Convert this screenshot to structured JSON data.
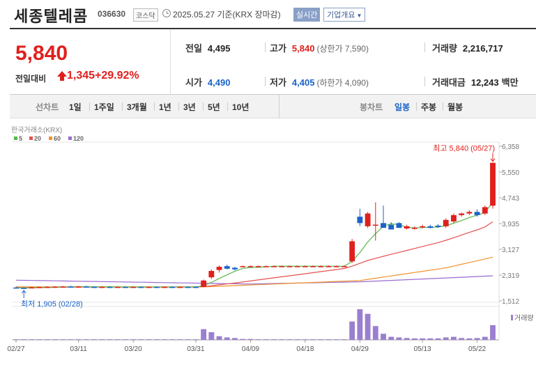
{
  "header": {
    "name": "세종텔레콤",
    "code": "036630",
    "market": "코스닥",
    "date_text": "2025.05.27 기준(KRX 장마감)",
    "realtime_label": "실시간",
    "overview_label": "기업개요",
    "overview_caret": "▼"
  },
  "summary": {
    "price": "5,840",
    "change_label": "전일대비",
    "change_value": "1,345",
    "change_pct": "+29.92%",
    "prev_close": {
      "label": "전일",
      "value": "4,495"
    },
    "high": {
      "label": "고가",
      "value": "5,840",
      "sub": "(상한가 7,590)"
    },
    "volume": {
      "label": "거래량",
      "value": "2,216,717"
    },
    "open": {
      "label": "시가",
      "value": "4,490"
    },
    "low": {
      "label": "저가",
      "value": "4,405",
      "sub": "(하한가 4,090)"
    },
    "amount": {
      "label": "거래대금",
      "value": "12,243",
      "unit": "백만"
    }
  },
  "periods": {
    "left": [
      "선차트",
      "1일",
      "1주일",
      "3개월",
      "1년",
      "3년",
      "5년",
      "10년"
    ],
    "right": [
      "봉차트",
      "일봉",
      "주봉",
      "월봉"
    ],
    "active": "일봉"
  },
  "colors": {
    "up": "#e0201d",
    "down": "#1a63c9",
    "ma5": "#55b84a",
    "ma20": "#e65050",
    "ma60": "#f0922b",
    "ma120": "#9a6bd0",
    "volume": "#9b7fcf"
  },
  "chart_data": {
    "type": "candlestick",
    "source_label": "한국거래소(KRX)",
    "legend": [
      {
        "name": "5",
        "color": "#55b84a"
      },
      {
        "name": "20",
        "color": "#e65050"
      },
      {
        "name": "60",
        "color": "#f0922b"
      },
      {
        "name": "120",
        "color": "#9a6bd0"
      }
    ],
    "y_ticks": [
      "6,358",
      "5,550",
      "4,743",
      "3,935",
      "3,127",
      "2,319",
      "1,512"
    ],
    "ylim": [
      1512,
      6358
    ],
    "x_ticks": [
      "02/27",
      "03/11",
      "03/20",
      "03/31",
      "04/09",
      "04/18",
      "04/29",
      "05/13",
      "05/22"
    ],
    "x_tick_index": [
      0,
      8,
      15,
      23,
      30,
      37,
      44,
      52,
      59
    ],
    "n_days": 62,
    "high_annotation": "최고 5,840 (05/27)",
    "low_annotation": "최저 1,905 (02/28)",
    "volume_label": "거래량",
    "candles": [
      [
        1930,
        1960,
        1900,
        1920
      ],
      [
        1920,
        1940,
        1905,
        1915
      ],
      [
        1915,
        1950,
        1905,
        1935
      ],
      [
        1935,
        1960,
        1920,
        1945
      ],
      [
        1945,
        1970,
        1930,
        1950
      ],
      [
        1950,
        1975,
        1935,
        1955
      ],
      [
        1955,
        1980,
        1940,
        1960
      ],
      [
        1960,
        1985,
        1945,
        1955
      ],
      [
        1955,
        1980,
        1940,
        1960
      ],
      [
        1960,
        1985,
        1945,
        1950
      ],
      [
        1950,
        1975,
        1935,
        1945
      ],
      [
        1945,
        1970,
        1930,
        1950
      ],
      [
        1950,
        1975,
        1935,
        1945
      ],
      [
        1945,
        1970,
        1930,
        1950
      ],
      [
        1950,
        1975,
        1935,
        1945
      ],
      [
        1945,
        1965,
        1930,
        1950
      ],
      [
        1950,
        1970,
        1935,
        1945
      ],
      [
        1945,
        1965,
        1930,
        1950
      ],
      [
        1950,
        1970,
        1935,
        1945
      ],
      [
        1945,
        1965,
        1930,
        1950
      ],
      [
        1950,
        1970,
        1935,
        1945
      ],
      [
        1945,
        1965,
        1930,
        1950
      ],
      [
        1950,
        1970,
        1935,
        1945
      ],
      [
        1950,
        1970,
        1935,
        1945
      ],
      [
        1950,
        2180,
        1940,
        2150
      ],
      [
        2250,
        2500,
        2200,
        2450
      ],
      [
        2480,
        2620,
        2400,
        2580
      ],
      [
        2600,
        2650,
        2500,
        2520
      ],
      [
        2550,
        2580,
        2460,
        2500
      ],
      [
        2600,
        2620,
        2590,
        2600
      ],
      [
        2600,
        2620,
        2590,
        2600
      ],
      [
        2600,
        2620,
        2590,
        2600
      ],
      [
        2600,
        2620,
        2590,
        2600
      ],
      [
        2600,
        2620,
        2590,
        2600
      ],
      [
        2600,
        2620,
        2590,
        2600
      ],
      [
        2600,
        2620,
        2590,
        2600
      ],
      [
        2600,
        2620,
        2590,
        2600
      ],
      [
        2600,
        2620,
        2590,
        2600
      ],
      [
        2600,
        2620,
        2590,
        2600
      ],
      [
        2600,
        2620,
        2590,
        2600
      ],
      [
        2600,
        2620,
        2590,
        2600
      ],
      [
        2600,
        2620,
        2590,
        2600
      ],
      [
        2600,
        2620,
        2590,
        2600
      ],
      [
        2750,
        3450,
        2700,
        3380
      ],
      [
        4150,
        4400,
        3850,
        3950
      ],
      [
        3850,
        4300,
        3800,
        4250
      ],
      [
        3900,
        4600,
        3400,
        3900
      ],
      [
        3950,
        4500,
        3850,
        3800
      ],
      [
        3900,
        3980,
        3750,
        3750
      ],
      [
        3950,
        3980,
        3800,
        3800
      ],
      [
        3780,
        3900,
        3750,
        3850
      ],
      [
        3800,
        3850,
        3750,
        3800
      ],
      [
        3820,
        3900,
        3780,
        3850
      ],
      [
        3850,
        3900,
        3780,
        3800
      ],
      [
        3870,
        3920,
        3800,
        3830
      ],
      [
        3850,
        4100,
        3800,
        4050
      ],
      [
        4000,
        4250,
        3950,
        4200
      ],
      [
        4200,
        4280,
        4150,
        4250
      ],
      [
        4250,
        4350,
        4200,
        4300
      ],
      [
        4300,
        4380,
        4150,
        4200
      ],
      [
        4250,
        4500,
        4200,
        4450
      ],
      [
        4495,
        5840,
        4405,
        5840
      ]
    ],
    "volume": [
      0.02,
      0.02,
      0.02,
      0.02,
      0.02,
      0.02,
      0.02,
      0.02,
      0.02,
      0.02,
      0.02,
      0.02,
      0.02,
      0.02,
      0.02,
      0.02,
      0.02,
      0.02,
      0.02,
      0.02,
      0.02,
      0.02,
      0.02,
      0.02,
      0.35,
      0.25,
      0.12,
      0.08,
      0.06,
      0.03,
      0.03,
      0.02,
      0.02,
      0.02,
      0.02,
      0.02,
      0.02,
      0.02,
      0.02,
      0.02,
      0.02,
      0.02,
      0.02,
      0.6,
      1.0,
      0.85,
      0.45,
      0.2,
      0.1,
      0.08,
      0.06,
      0.05,
      0.05,
      0.05,
      0.05,
      0.08,
      0.1,
      0.06,
      0.05,
      0.06,
      0.1,
      0.48
    ]
  }
}
